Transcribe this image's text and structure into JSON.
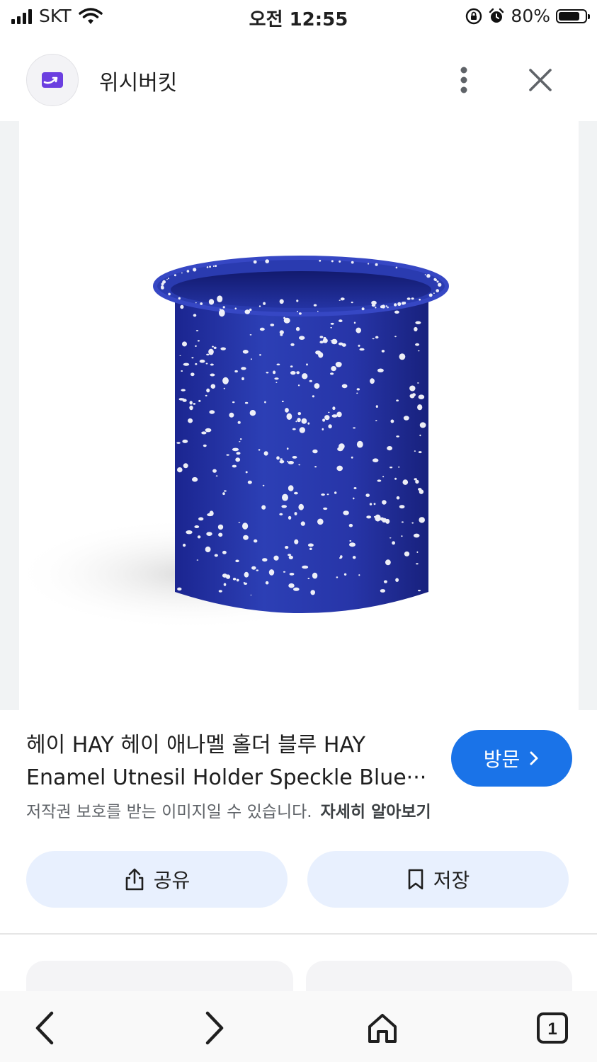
{
  "status_bar": {
    "carrier": "SKT",
    "time": "오전 12:55",
    "battery_percent": "80%",
    "battery_level": 0.8
  },
  "header": {
    "site_name": "위시버킷",
    "site_logo_icon": "wishbucket-logo-icon",
    "more_icon": "more-vert-icon",
    "close_icon": "close-icon"
  },
  "image": {
    "subject": "blue-speckled-enamel-utensil-holder",
    "colors": {
      "enamel": "#2b3aa8",
      "speckle": "#ffffff",
      "side_panel": "#f1f3f4"
    }
  },
  "info": {
    "title_line1": "헤이 HAY 헤이 애나멜 홀더 블루 HAY",
    "title_line2": "Enamel Utnesil Holder Speckle Blue···",
    "copyright_notice": "저작권 보호를 받는 이미지일 수 있습니다.",
    "learn_more": "자세히 알아보기"
  },
  "actions": {
    "visit_label": "방문",
    "share_label": "공유",
    "save_label": "저장"
  },
  "bottom_nav": {
    "tab_count": "1"
  },
  "colors": {
    "accent": "#1a73e8",
    "action_button_bg": "#e8f0fe",
    "logo_purple": "#6b3fe0"
  }
}
